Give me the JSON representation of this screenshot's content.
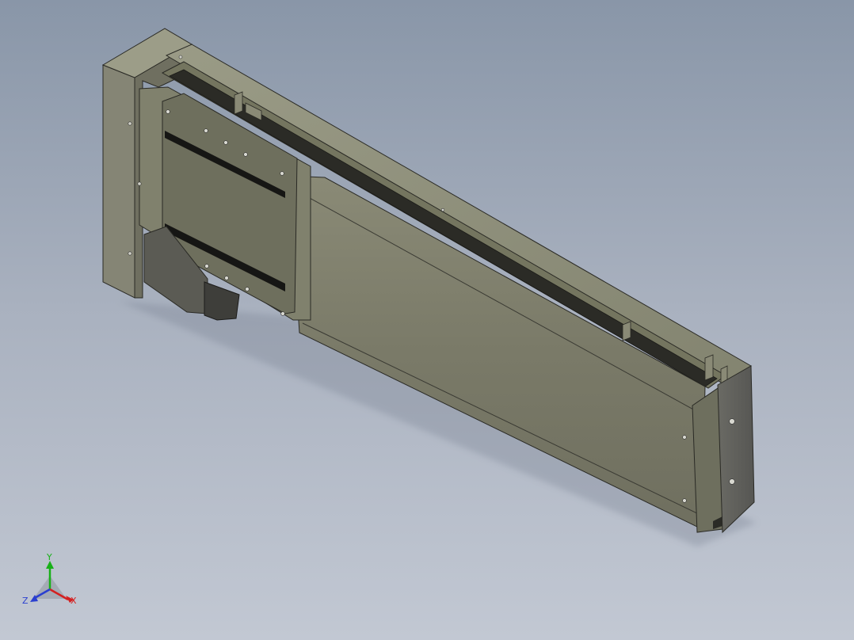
{
  "viewport": {
    "name": "3d-model-viewport",
    "background_top": "#8996a8",
    "background_bottom": "#c2c8d3"
  },
  "model": {
    "type": "linear-actuator",
    "face_color": "#7c7c6a",
    "top_color": "#8e8f7c",
    "end_cap_color": "#5f5f5b",
    "dark_color": "#1f1f1f"
  },
  "triad": {
    "x_label": "X",
    "y_label": "Y",
    "z_label": "Z",
    "x_color": "#d42020",
    "y_color": "#18b018",
    "z_color": "#2a3fd0"
  }
}
